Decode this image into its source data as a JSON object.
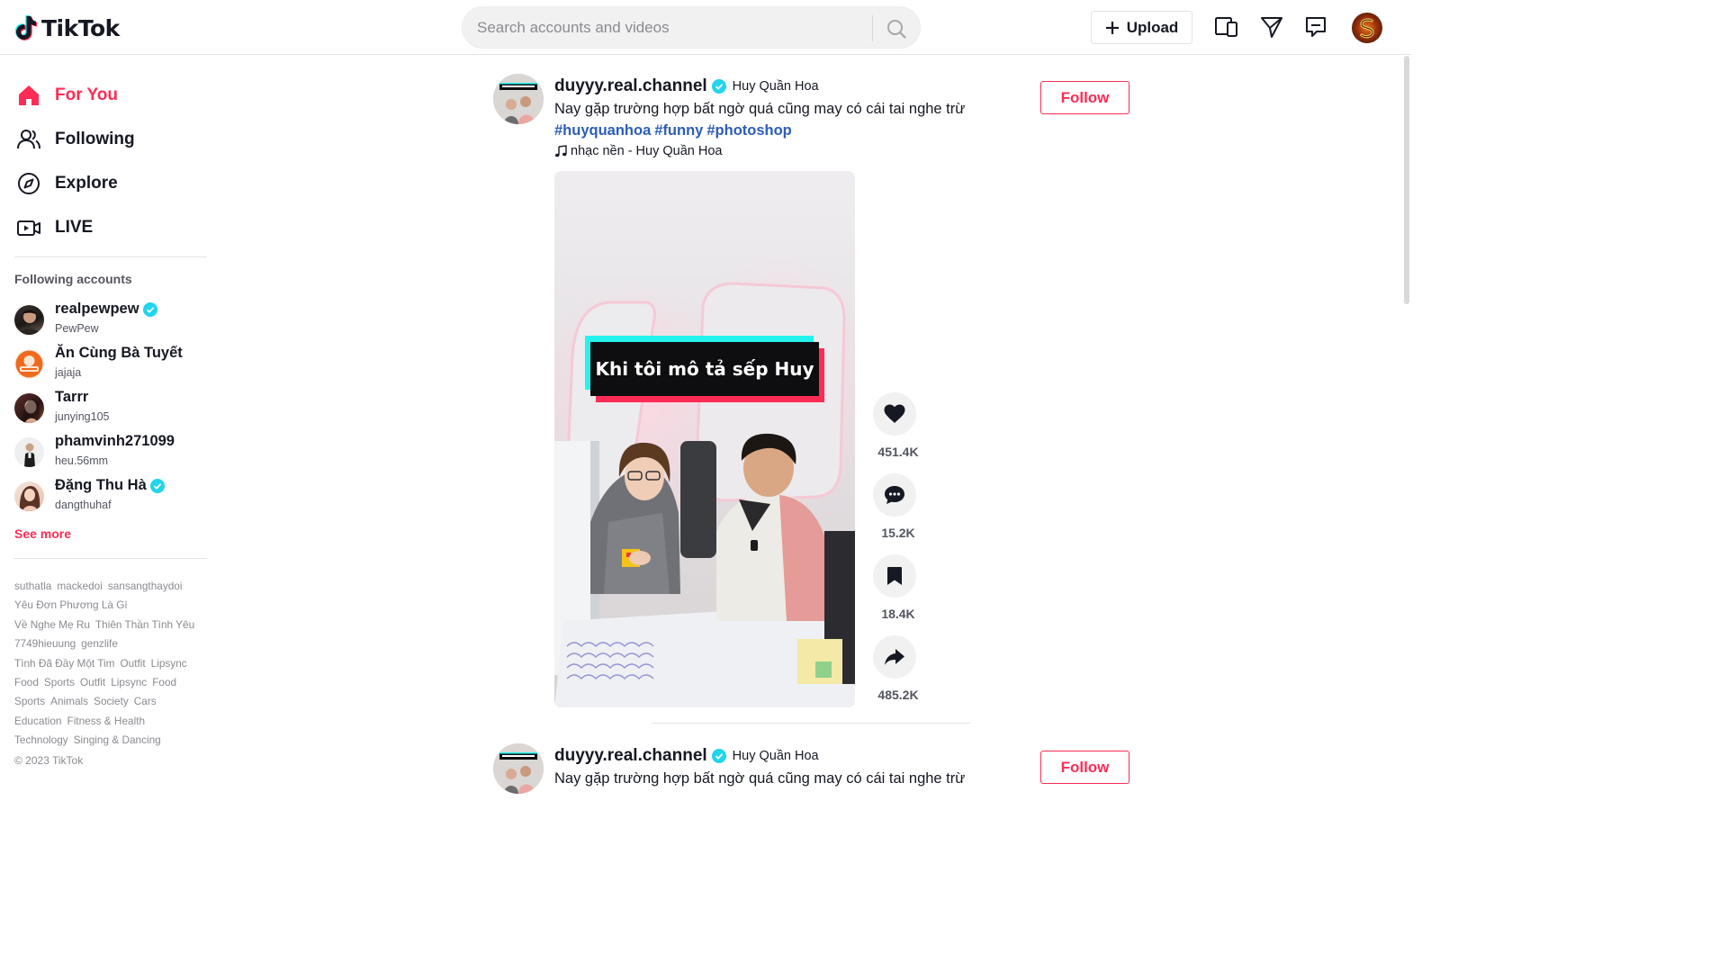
{
  "header": {
    "logo_text": "TikTok",
    "search_placeholder": "Search accounts and videos",
    "upload_label": "Upload",
    "icons": [
      "search-icon",
      "plus-icon",
      "devices-icon",
      "send-icon",
      "inbox-icon"
    ],
    "brand_color": "#fe2c55"
  },
  "sidebar": {
    "nav": [
      {
        "label": "For You",
        "icon": "home-icon",
        "active": true
      },
      {
        "label": "Following",
        "icon": "users-icon",
        "active": false
      },
      {
        "label": "Explore",
        "icon": "compass-icon",
        "active": false
      },
      {
        "label": "LIVE",
        "icon": "live-camera-icon",
        "active": false
      }
    ],
    "following_title": "Following accounts",
    "accounts": [
      {
        "name": "realpewpew",
        "sub": "PewPew",
        "verified": true
      },
      {
        "name": "Ăn Cùng Bà Tuyết",
        "sub": "jajaja",
        "verified": false
      },
      {
        "name": "Tarrr",
        "sub": "junying105",
        "verified": false
      },
      {
        "name": "phamvinh271099",
        "sub": "heu.56mm",
        "verified": false
      },
      {
        "name": "Đặng Thu Hà",
        "sub": "dangthuhaf",
        "verified": true
      }
    ],
    "see_more": "See more",
    "tag_lines": [
      [
        "suthatla",
        "mackedoi",
        "sansangthaydoi"
      ],
      [
        "Yêu Đơn Phương Là Gì"
      ],
      [
        "Về Nghe Mẹ Ru",
        "Thiên Thần Tình Yêu"
      ],
      [
        "7749hieuung",
        "genzlife"
      ],
      [
        "Tình Đã Đầy Một Tim",
        "Outfit",
        "Lipsync"
      ],
      [
        "Food",
        "Sports",
        "Outfit",
        "Lipsync",
        "Food"
      ],
      [
        "Sports",
        "Animals",
        "Society",
        "Cars"
      ],
      [
        "Education",
        "Fitness & Health"
      ],
      [
        "Technology",
        "Singing & Dancing"
      ]
    ],
    "copyright": "© 2023 TikTok"
  },
  "posts": [
    {
      "username": "duyyy.real.channel",
      "nickname": "Huy Quần Hoa",
      "verified": true,
      "description": "Nay gặp trường hợp bất ngờ quá cũng may có cái tai nghe trừ",
      "hashtags": [
        "#huyquanhoa",
        "#funny",
        "#photoshop"
      ],
      "music": "nhạc nền - Huy Quần Hoa",
      "follow_label": "Follow",
      "video_caption": "Khi tôi mô tả sếp Huy",
      "likes": "451.4K",
      "comments": "15.2K",
      "saves": "18.4K",
      "shares": "485.2K"
    },
    {
      "username": "duyyy.real.channel",
      "nickname": "Huy Quần Hoa",
      "verified": true,
      "description": "Nay gặp trường hợp bất ngờ quá cũng may có cái tai nghe trừ",
      "follow_label": "Follow"
    }
  ]
}
